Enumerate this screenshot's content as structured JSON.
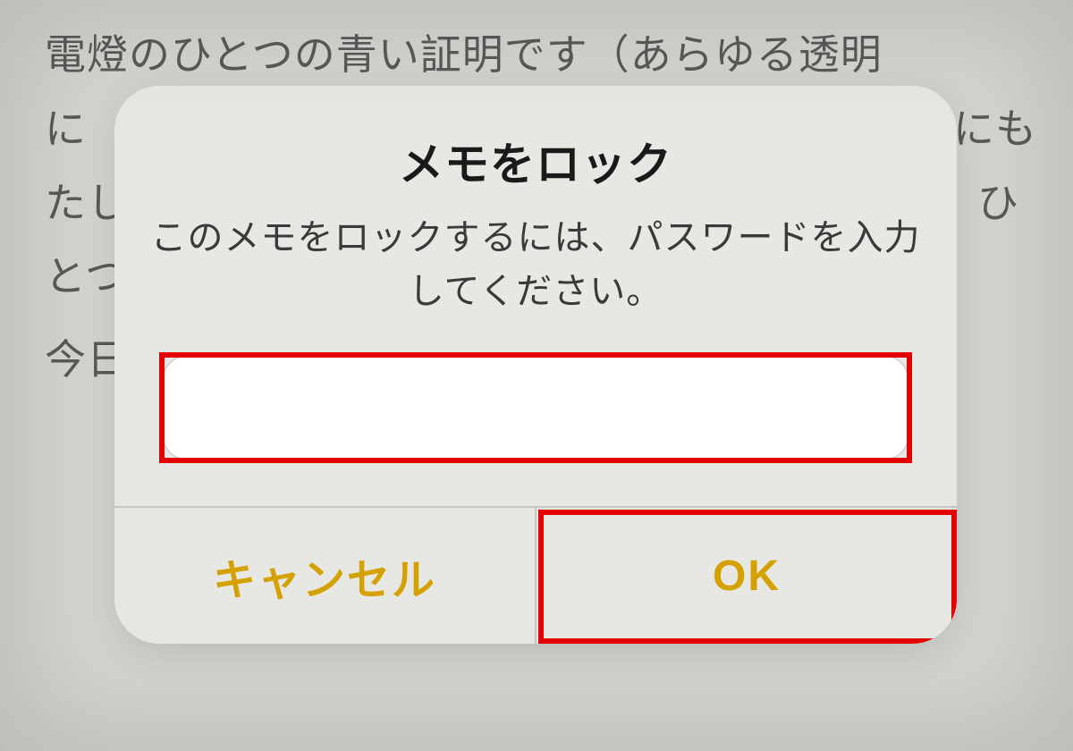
{
  "note": {
    "line1": "電燈のひとつの青い証明です（あらゆる透明",
    "line2_left": "に",
    "line2_right": "にも",
    "line3_left": "たし",
    "line3_right": "ひ",
    "line4_left": "とつ",
    "line5_left": "今日"
  },
  "dialog": {
    "title": "メモをロック",
    "message": "このメモをロックするには、パスワードを入力してください。",
    "password_value": "",
    "cancel_label": "キャンセル",
    "ok_label": "OK"
  },
  "colors": {
    "accent": "#d4a100",
    "highlight": "#e40000"
  }
}
